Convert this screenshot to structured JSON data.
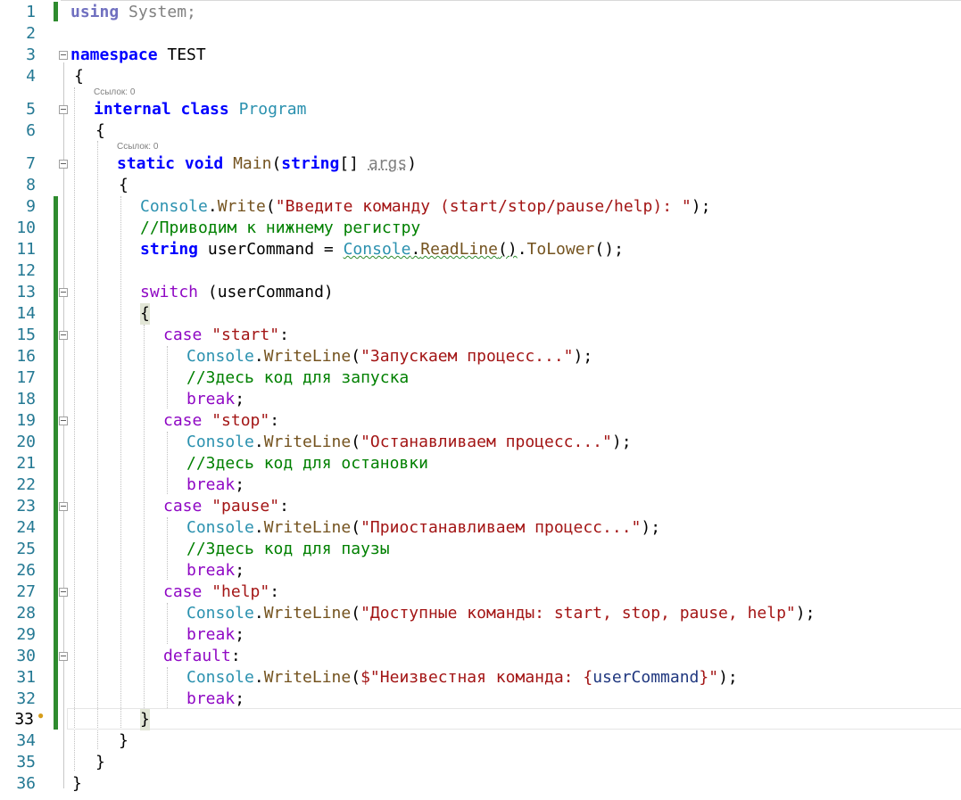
{
  "editor": {
    "language": "C#",
    "current_line": 33,
    "reference_hint": "Ссылок: 0",
    "lines": [
      {
        "n": "1"
      },
      {
        "n": "2"
      },
      {
        "n": "3"
      },
      {
        "n": "4"
      },
      {
        "n": "5"
      },
      {
        "n": "6"
      },
      {
        "n": "7"
      },
      {
        "n": "8"
      },
      {
        "n": "9"
      },
      {
        "n": "10"
      },
      {
        "n": "11"
      },
      {
        "n": "12"
      },
      {
        "n": "13"
      },
      {
        "n": "14"
      },
      {
        "n": "15"
      },
      {
        "n": "16"
      },
      {
        "n": "17"
      },
      {
        "n": "18"
      },
      {
        "n": "19"
      },
      {
        "n": "20"
      },
      {
        "n": "21"
      },
      {
        "n": "22"
      },
      {
        "n": "23"
      },
      {
        "n": "24"
      },
      {
        "n": "25"
      },
      {
        "n": "26"
      },
      {
        "n": "27"
      },
      {
        "n": "28"
      },
      {
        "n": "29"
      },
      {
        "n": "30"
      },
      {
        "n": "31"
      },
      {
        "n": "32"
      },
      {
        "n": "33"
      },
      {
        "n": "34"
      },
      {
        "n": "35"
      },
      {
        "n": "36"
      }
    ],
    "tokens": {
      "l1_using": "using",
      "l1_system": " System;",
      "l3_namespace": "namespace",
      "l3_name": " TEST",
      "l4": "{",
      "l5_internal": "internal",
      "l5_class": "class",
      "l5_program": "Program",
      "l6": "{",
      "l7_static": "static",
      "l7_void": "void",
      "l7_main": "Main",
      "l7_paren": "(",
      "l7_string": "string",
      "l7_arr": "[] ",
      "l7_args": "args",
      "l7_close": ")",
      "l8": "{",
      "console": "Console",
      "dot": ".",
      "write": "Write",
      "writeline": "WriteLine",
      "l9_str": "\"Введите команду (start/stop/pause/help): \"",
      "l10_comment": "//Приводим к нижнему регистру",
      "l11_string": "string",
      "l11_var": " userCommand = ",
      "l11_readline": "ReadLine",
      "l11_parens": "()",
      "l11_tolower": "ToLower",
      "l11_end": "();",
      "l13_switch": "switch",
      "l13_rest": " (userCommand)",
      "l14": "{",
      "case": "case",
      "break": "break",
      "default": "default",
      "l15_str": "\"start\"",
      "l16_str": "\"Запускаем процесс...\"",
      "l17_comment": "//Здесь код для запуска",
      "l19_str": "\"stop\"",
      "l20_str": "\"Останавливаем процесс...\"",
      "l21_comment": "//Здесь код для остановки",
      "l23_str": "\"pause\"",
      "l24_str": "\"Приостанавливаем процесс...\"",
      "l25_comment": "//Здесь код для паузы",
      "l27_str": "\"help\"",
      "l28_str": "\"Доступные команды: start, stop, pause, help\"",
      "l31_str1": "$\"Неизвестная команда: {",
      "l31_var": "userCommand",
      "l31_str2": "}\"",
      "l33": "}",
      "l34": "}",
      "l35": "}",
      "l36": "}",
      "open": "(",
      "close_semi": ");",
      "colon": ":",
      "semi": ";"
    }
  },
  "colors": {
    "keyword": "#0000ff",
    "control_keyword": "#8f08c4",
    "type": "#2b91af",
    "method": "#74531f",
    "string": "#a31515",
    "comment": "#008000",
    "change_bar": "#2e8b2e",
    "line_number": "#2b91af"
  }
}
